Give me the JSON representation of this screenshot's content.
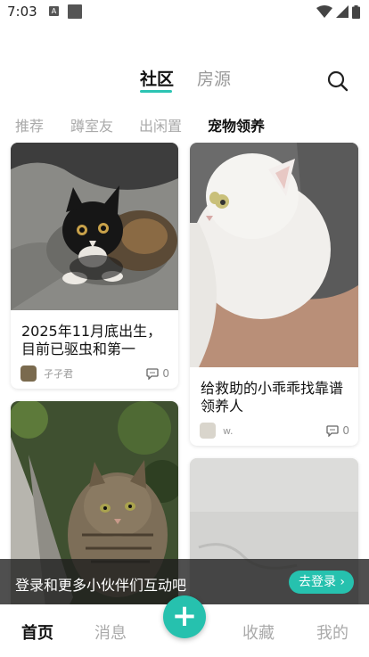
{
  "status_bar": {
    "time": "7:03",
    "notif_a": "A"
  },
  "header": {
    "tabs": [
      {
        "label": "社区",
        "active": true
      },
      {
        "label": "房源",
        "active": false
      }
    ]
  },
  "subtabs": [
    "推荐",
    "蹲室友",
    "出闲置",
    "宠物领养"
  ],
  "posts": [
    {
      "title_line1": "2025年11月底出生，",
      "title_line2": "目前已驱虫和第一",
      "author": "孑孑君",
      "comments": "0",
      "image": "black-tabby-kitten-photo"
    },
    {
      "title_line1": "给救助的小乖乖找靠谱",
      "title_line2": "领养人",
      "author": "w.",
      "comments": "0",
      "image": "white-longhair-cat-photo"
    },
    {
      "image": "tabby-cat-on-wall-photo"
    },
    {
      "image": "grey-wall-photo"
    }
  ],
  "login_banner": {
    "text": "登录和更多小伙伴们互动吧",
    "button": "去登录"
  },
  "bottom_nav": {
    "items": [
      {
        "label": "首页",
        "active": true
      },
      {
        "label": "消息",
        "active": false
      },
      {
        "label": "收藏",
        "active": false
      },
      {
        "label": "我的",
        "active": false
      }
    ],
    "fab": "+"
  },
  "colors": {
    "accent": "#26c1ae"
  }
}
